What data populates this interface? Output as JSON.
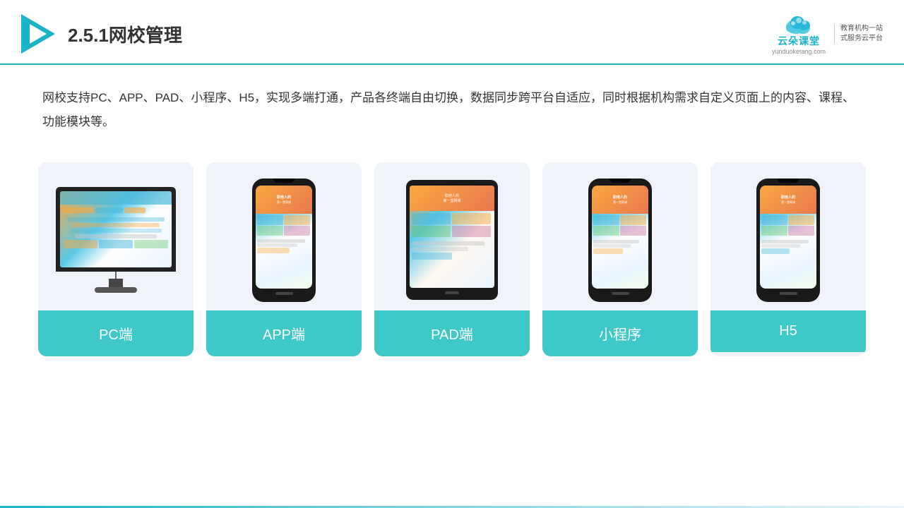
{
  "header": {
    "title": "2.5.1网校管理",
    "title_number": "2.5.1",
    "title_text": "网校管理"
  },
  "logo": {
    "name_cn": "云朵课堂",
    "name_en": "yunduoketang.com",
    "slogan_line1": "教育机构一站",
    "slogan_line2": "式服务云平台"
  },
  "description": {
    "text": "网校支持PC、APP、PAD、小程序、H5，实现多端打通，产品各终端自由切换，数据同步跨平台自适应，同时根据机构需求自定义页面上的内容、课程、功能模块等。"
  },
  "cards": [
    {
      "id": "pc",
      "label": "PC端",
      "device": "pc"
    },
    {
      "id": "app",
      "label": "APP端",
      "device": "phone"
    },
    {
      "id": "pad",
      "label": "PAD端",
      "device": "tablet"
    },
    {
      "id": "miniapp",
      "label": "小程序",
      "device": "phone"
    },
    {
      "id": "h5",
      "label": "H5",
      "device": "phone"
    }
  ]
}
